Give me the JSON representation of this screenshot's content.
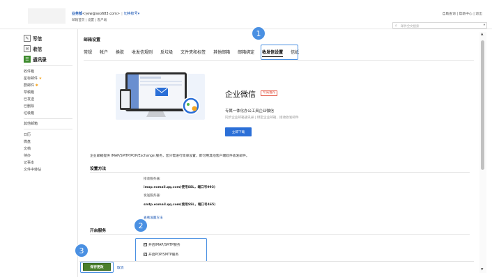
{
  "header": {
    "account_name": "业务部",
    "account_email": "<yew@seo683.com>",
    "switch_label": "切换帐号▾",
    "breadcrumbs": "邮箱首页 | 设置 | 客户端",
    "top_links": "自助查询 | 帮助中心 | 退出",
    "search_placeholder": "邮件全文搜索"
  },
  "sidebar": {
    "main": [
      {
        "label": "写信",
        "icon": "compose-icon"
      },
      {
        "label": "收信",
        "icon": "inbox-icon"
      },
      {
        "label": "通讯录",
        "icon": "contacts-icon"
      }
    ],
    "folders": [
      "收件箱",
      "星标邮件",
      "群邮件",
      "草稿箱",
      "已发送",
      "已删除",
      "垃圾箱",
      "其他邮箱"
    ],
    "tools": [
      "日历",
      "微盘",
      "文档",
      "待办",
      "记事本",
      "文件中转站"
    ]
  },
  "main": {
    "page_title": "邮箱设置",
    "tabs": [
      "常规",
      "帐户",
      "换肤",
      "收发信规则",
      "反垃圾",
      "文件夹和标签",
      "其他邮箱",
      "邮箱绑定",
      "收发信设置",
      "信纸"
    ],
    "active_tab": "收发信设置",
    "promo": {
      "title": "企业微信",
      "tag": "专属推荐",
      "subtitle": "专属一体化办公工具企业微信",
      "desc": "同步企业邮箱通讯录 | 绑定企业邮箱，接收收发邮件",
      "button": "立即下载"
    },
    "description": "企业邮箱提供 IMAP/SMTP/POP/Exchange 服务，您只需进行简单设置，即可用其他客户端软件收发邮件。",
    "setup_title": "设置方法",
    "receive_label": "接收服务器:",
    "receive_value": "imap.exmail.qq.com(使用SSL，端口号993)",
    "send_label": "发送服务器:",
    "send_value": "smtp.exmail.qq.com(使用SSL，端口号465)",
    "more_link": "查看设置方法",
    "service_title": "开启服务",
    "options": [
      {
        "label": "开启IMAP/SMTP服务",
        "checked": true
      },
      {
        "label": "开启POP/SMTP服务",
        "checked": true
      }
    ],
    "save_button": "保存更改",
    "cancel_link": "取消"
  },
  "markers": [
    "1",
    "2",
    "3"
  ],
  "colors": {
    "accent": "#4a90e2",
    "save_green": "#4a7f2c",
    "link_blue": "#1a56b4",
    "download_blue": "#2b6fd7"
  }
}
